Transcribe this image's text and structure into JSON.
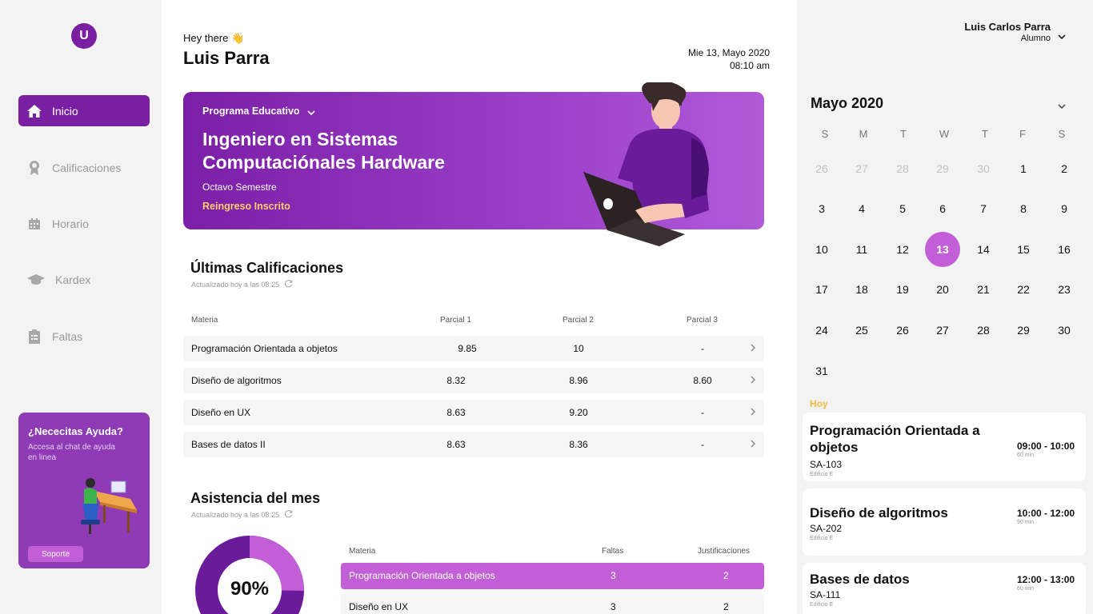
{
  "sidebar": {
    "logo_text": "U",
    "items": [
      {
        "label": "Inicio",
        "icon": "home-icon"
      },
      {
        "label": "Calificaciones",
        "icon": "award-icon"
      },
      {
        "label": "Horario",
        "icon": "calendar-icon"
      },
      {
        "label": "Kardex",
        "icon": "graduation-cap-icon"
      },
      {
        "label": "Faltas",
        "icon": "clipboard-icon"
      }
    ],
    "help": {
      "title": "¿Nececitas Ayuda?",
      "subtitle": "Accesa al chat de ayuda en linea",
      "button": "Soporte"
    }
  },
  "header": {
    "greeting": "Hey there 👋",
    "name": "Luis Parra",
    "date": "Mie 13, Mayo 2020",
    "time": "08:10 am"
  },
  "banner": {
    "label": "Programa Educativo",
    "title": "Ingeniero en Sistemas Computaciónales Hardware",
    "semester": "Octavo Semestre",
    "status": "Reingreso Inscrito"
  },
  "grades": {
    "title": "Últimas Calificaciones",
    "updated": "Actualizado hoy a las 08:25",
    "headers": [
      "Materia",
      "Parcial 1",
      "Parcial 2",
      "Parcial 3"
    ],
    "rows": [
      {
        "subject": "Programación Orientada a objetos",
        "p1": "9.85",
        "p2": "10",
        "p3": "-"
      },
      {
        "subject": "Diseño de algoritmos",
        "p1": "8.32",
        "p2": "8.96",
        "p3": "8.60"
      },
      {
        "subject": "Diseño en UX",
        "p1": "8.63",
        "p2": "9.20",
        "p3": "-"
      },
      {
        "subject": "Bases de datos II",
        "p1": "8.63",
        "p2": "8.36",
        "p3": "-"
      }
    ]
  },
  "attendance": {
    "title": "Asistencia del mes",
    "updated": "Actualizado hoy a las 08:25",
    "percent_label": "90%",
    "percent_value": 90,
    "headers": [
      "Materia",
      "Faltas",
      "Justificaciones"
    ],
    "rows": [
      {
        "subject": "Programación Orientada a objetos",
        "faltas": "3",
        "just": "2"
      },
      {
        "subject": "Diseño en UX",
        "faltas": "3",
        "just": "2"
      }
    ]
  },
  "user": {
    "name": "Luis Carlos Parra",
    "role": "Alumno"
  },
  "calendar": {
    "title": "Mayo 2020",
    "days_of_week": [
      "S",
      "M",
      "T",
      "W",
      "T",
      "F",
      "S"
    ],
    "weeks": [
      [
        "26",
        "27",
        "28",
        "29",
        "30",
        "1",
        "2"
      ],
      [
        "3",
        "4",
        "5",
        "6",
        "7",
        "8",
        "9"
      ],
      [
        "10",
        "11",
        "12",
        "13",
        "14",
        "15",
        "16"
      ],
      [
        "17",
        "18",
        "19",
        "20",
        "21",
        "22",
        "23"
      ],
      [
        "24",
        "25",
        "26",
        "27",
        "28",
        "29",
        "30"
      ],
      [
        "31"
      ]
    ],
    "muted": [
      "26",
      "27",
      "28",
      "29",
      "30"
    ],
    "today": "13"
  },
  "today": {
    "label": "Hoy",
    "classes": [
      {
        "subject": "Programación Orientada a objetos",
        "room": "SA-103",
        "building": "Edificio E",
        "time": "09:00 - 10:00",
        "duration": "60 min"
      },
      {
        "subject": "Diseño de algoritmos",
        "room": "SA-202",
        "building": "Edificio E",
        "time": "10:00 - 12:00",
        "duration": "90 min"
      },
      {
        "subject": "Bases de datos",
        "room": "SA-111",
        "building": "Edificio E",
        "time": "12:00 - 13:00",
        "duration": "60 min"
      }
    ]
  },
  "colors": {
    "primary": "#7b1fa2",
    "accent": "#c25fd6",
    "highlight": "#ffcf6b",
    "today_label": "#f4b942"
  }
}
